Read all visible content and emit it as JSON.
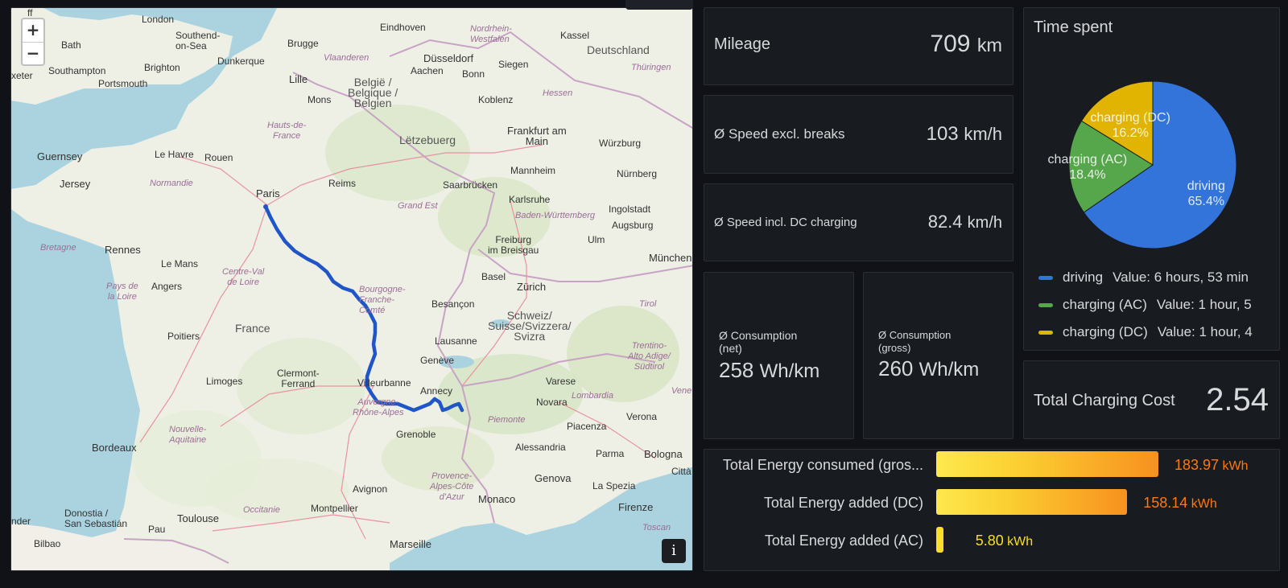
{
  "map": {
    "zoom_in": "+",
    "zoom_out": "−",
    "info": "i",
    "labels": {
      "london": "London",
      "southend": "Southend-\non-Sea",
      "bath": "Bath",
      "brighton": "Brighton",
      "southampton": "Southampton",
      "portsmouth": "Portsmouth",
      "exeter": "xeter",
      "brugge": "Brugge",
      "dunkerque": "Dunkerque",
      "vlaanderen": "Vlaanderen",
      "lille": "Lille",
      "eindhoven": "Eindhoven",
      "nordrhein": "Nordrhein-\nWestfalen",
      "kassel": "Kassel",
      "dusseldorf": "Düsseldorf",
      "siegen": "Siegen",
      "deutschland": "Deutschland",
      "thuringen": "Thüringen",
      "aachen": "Aachen",
      "bonn": "Bonn",
      "belgie": "België /\nBelgique /\nBelgien",
      "mons": "Mons",
      "koblenz": "Koblenz",
      "hessen": "Hessen",
      "hauts": "Hauts-de-\nFrance",
      "frankfurt": "Frankfurt am\nMain",
      "wurzburg": "Würzburg",
      "letzebuerg": "Lëtzebuerg",
      "guernsey": "Guernsey",
      "lehavre": "Le Havre",
      "rouen": "Rouen",
      "jersey": "Jersey",
      "normandie": "Normandie",
      "reims": "Reims",
      "mannheim": "Mannheim",
      "nurnberg": "Nürnberg",
      "saarbrucken": "Saarbrücken",
      "paris": "Paris",
      "karlsruhe": "Karlsruhe",
      "grandest": "Grand Est",
      "ingolstadt": "Ingolstadt",
      "badenw": "Baden-Württemberg",
      "augsburg": "Augsburg",
      "bretagne": "Bretagne",
      "rennes": "Rennes",
      "freiburg": "Freiburg\nim Breisgau",
      "ulm": "Ulm",
      "lemans": "Le Mans",
      "centre": "Centre-Val\nde Loire",
      "munchen": "München",
      "angers": "Angers",
      "paysdelaloire": "Pays de\nla Loire",
      "basel": "Basel",
      "zurich": "Zürich",
      "bourgogne": "Bourgogne-\nFranche-\nComté",
      "tirol": "Tirol",
      "besancon": "Besançon",
      "schweiz": "Schweiz/\nSuisse/Svizzera/\nSvizra",
      "france": "France",
      "poitiers": "Poitiers",
      "lausanne": "Lausanne",
      "trentino": "Trentino-\nAlto Adige/\nSüdtirol",
      "geneve": "Genève",
      "clermont": "Clermont-\nFerrand",
      "limoges": "Limoges",
      "villeurbanne": "Villeurbanne",
      "varese": "Varese",
      "annecy": "Annecy",
      "novara": "Novara",
      "lombardia": "Lombardia",
      "verona": "Verona",
      "vene": "Vene",
      "auvergne": "Auvergne-\nRhône-Alpes",
      "nouvelle": "Nouvelle-\nAquitaine",
      "piemonte": "Piemonte",
      "piacenza": "Piacenza",
      "grenoble": "Grenoble",
      "bordeaux": "Bordeaux",
      "alessandria": "Alessandria",
      "parma": "Parma",
      "bologna": "Bologna",
      "genova": "Genova",
      "citta": "Città",
      "provence": "Provence-\nAlpes-Côte\nd'Azur",
      "avignon": "Avignon",
      "laspezia": "La Spezia",
      "donostia": "Donostia /\nSan Sebastián",
      "toulouse": "Toulouse",
      "occitanie": "Occitanie",
      "montpellier": "Montpellier",
      "monaco": "Monaco",
      "firenze": "Firenze",
      "pau": "Pau",
      "toscana": "Toscan",
      "bilbao": "Bilbao",
      "marseille": "Marseille",
      "nder": "nder",
      "cardiff": "ff"
    }
  },
  "mileage": {
    "label": "Mileage",
    "value": "709",
    "unit": "km"
  },
  "speed_excl": {
    "label": "Ø Speed excl. breaks",
    "value": "103",
    "unit": "km/h"
  },
  "speed_incl": {
    "label": "Ø Speed incl. DC charging",
    "value": "82.4",
    "unit": "km/h"
  },
  "consumption_net": {
    "label_line1": "Ø Consumption",
    "label_line2": "(net)",
    "value": "258",
    "unit": "Wh/km"
  },
  "consumption_gross": {
    "label_line1": "Ø Consumption",
    "label_line2": "(gross)",
    "value": "260",
    "unit": "Wh/km"
  },
  "time_spent": {
    "title": "Time spent",
    "colors": {
      "driving": "#3274d9",
      "charging_ac": "#56a64b",
      "charging_dc": "#e0b400"
    },
    "slices": [
      {
        "name": "driving",
        "line1": "driving",
        "line2": "65.4%",
        "pct": 65.4
      },
      {
        "name": "charging (AC)",
        "line1": "charging (AC)",
        "line2": "18.4%",
        "pct": 18.4
      },
      {
        "name": "charging (DC)",
        "line1": "charging (DC)",
        "line2": "16.2%",
        "pct": 16.2
      }
    ],
    "legend": [
      {
        "name": "driving",
        "value": "Value: 6 hours, 53 min"
      },
      {
        "name": "charging (AC)",
        "value": "Value: 1 hour, 5"
      },
      {
        "name": "charging (DC)",
        "value": "Value: 1 hour, 4"
      }
    ]
  },
  "charging_cost": {
    "label": "Total Charging Cost",
    "value": "2.54"
  },
  "energy": {
    "colors": {
      "high": "#ff780a",
      "low": "#fade2a"
    },
    "bars": [
      {
        "label": "Total Energy consumed (gros...",
        "value": "183.97",
        "unit": "kWh",
        "amount": 183.97
      },
      {
        "label": "Total Energy added (DC)",
        "value": "158.14",
        "unit": "kWh",
        "amount": 158.14
      },
      {
        "label": "Total Energy added (AC)",
        "value": "5.80",
        "unit": "kWh",
        "amount": 5.8
      }
    ]
  }
}
